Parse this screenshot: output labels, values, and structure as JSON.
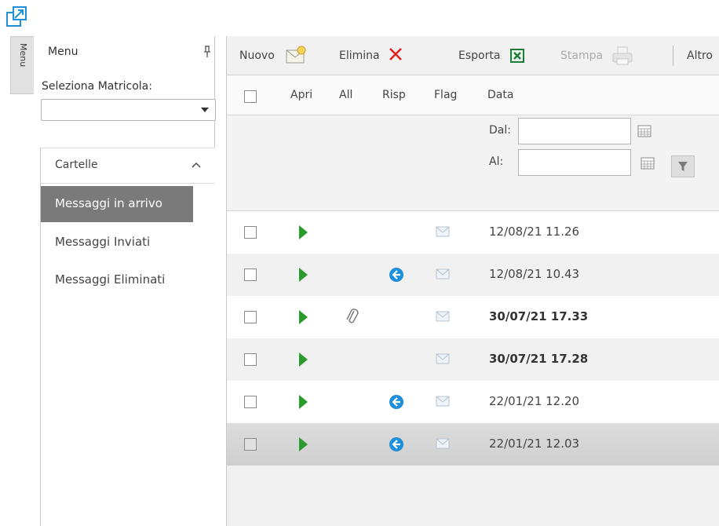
{
  "sidebar_tab": {
    "label": "Menu"
  },
  "sidebar": {
    "title": "Menu",
    "matricola_label": "Seleziona Matricola:",
    "matricola_value": "",
    "folders_header": "Cartelle",
    "folders": [
      {
        "label": "Messaggi in arrivo",
        "active": true
      },
      {
        "label": "Messaggi Inviati",
        "active": false
      },
      {
        "label": "Messaggi Eliminati",
        "active": false
      }
    ]
  },
  "toolbar": {
    "new_label": "Nuovo",
    "delete_label": "Elimina",
    "export_label": "Esporta",
    "print_label": "Stampa",
    "more_label": "Altro"
  },
  "columns": {
    "open": "Apri",
    "attachment": "All",
    "reply": "Risp",
    "flag": "Flag",
    "date": "Data"
  },
  "filter": {
    "from_label": "Dal:",
    "to_label": "Al:",
    "from_value": "",
    "to_value": ""
  },
  "messages": [
    {
      "date": "12/08/21 11.26",
      "attachment": false,
      "replied": false,
      "unread": false,
      "selected": false
    },
    {
      "date": "12/08/21 10.43",
      "attachment": false,
      "replied": true,
      "unread": false,
      "selected": false
    },
    {
      "date": "30/07/21 17.33",
      "attachment": true,
      "replied": false,
      "unread": true,
      "selected": false
    },
    {
      "date": "30/07/21 17.28",
      "attachment": false,
      "replied": false,
      "unread": true,
      "selected": false
    },
    {
      "date": "22/01/21 12.20",
      "attachment": false,
      "replied": true,
      "unread": false,
      "selected": false
    },
    {
      "date": "22/01/21 12.03",
      "attachment": false,
      "replied": true,
      "unread": false,
      "selected": true
    }
  ],
  "colors": {
    "accent": "#1e8fd9",
    "play": "#2a9c2a",
    "active_folder": "#7a7a7a",
    "delete": "#e0201c",
    "excel": "#1e7d3a"
  }
}
